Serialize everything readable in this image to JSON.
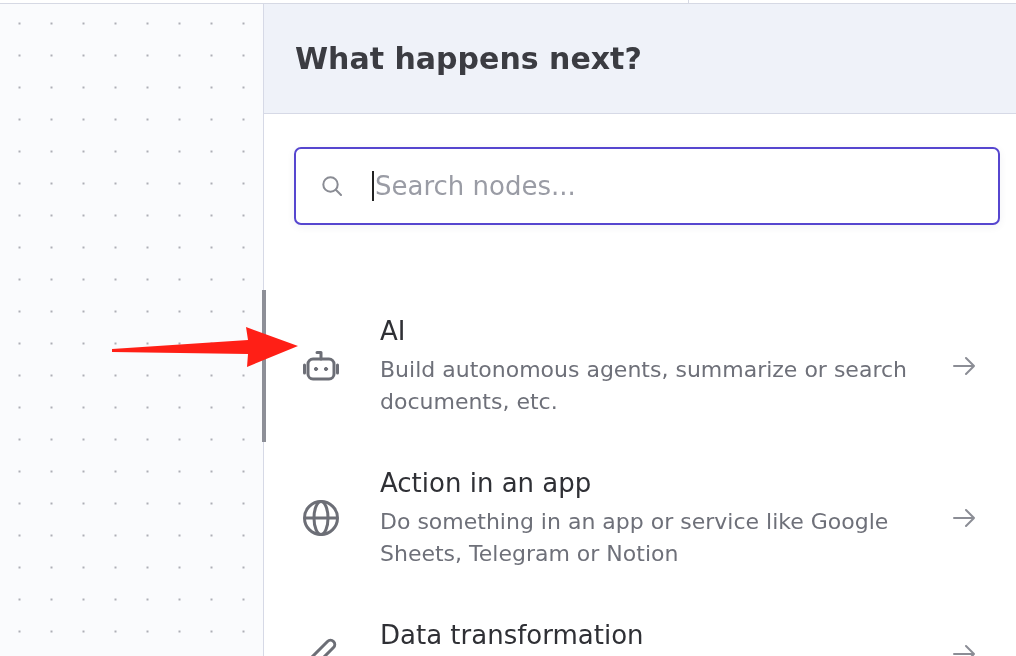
{
  "panel": {
    "title": "What happens next?"
  },
  "search": {
    "placeholder": "Search nodes...",
    "focused": true
  },
  "items": [
    {
      "kind": "ai",
      "title": "AI",
      "description": "Build autonomous agents, summarize or search documents, etc.",
      "selected": true
    },
    {
      "kind": "app",
      "title": "Action in an app",
      "description": "Do something in an app or service like Google Sheets, Telegram or Notion",
      "selected": false
    },
    {
      "kind": "transform",
      "title": "Data transformation",
      "selected": false
    }
  ]
}
